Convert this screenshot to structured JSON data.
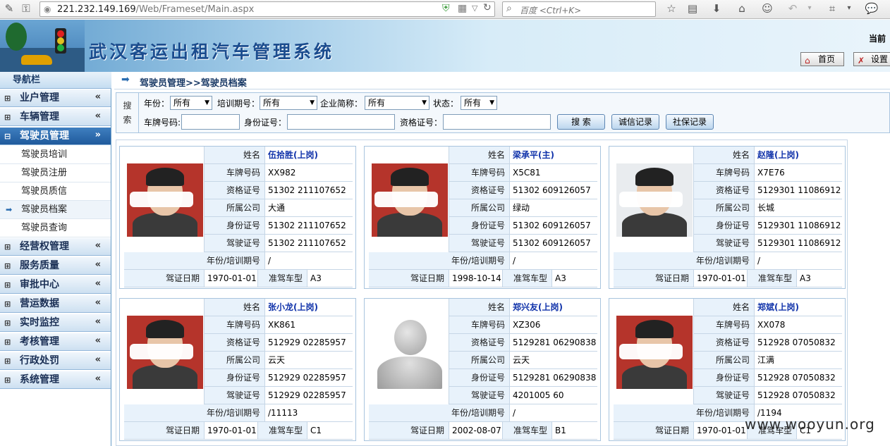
{
  "browser": {
    "url_host": "221.232.149.169",
    "url_path": "/Web/Frameset/Main.aspx",
    "search_placeholder": "百度 <Ctrl+K>"
  },
  "banner": {
    "title": "武汉客运出租汽车管理系统",
    "current_position": "当前",
    "home_label": "首页",
    "settings_label": "设置"
  },
  "sidebar": {
    "header": "导航栏",
    "groups": [
      {
        "label": "业户管理",
        "state": "collapsed"
      },
      {
        "label": "车辆管理",
        "state": "collapsed"
      },
      {
        "label": "驾驶员管理",
        "state": "expanded"
      },
      {
        "label": "经营权管理",
        "state": "collapsed"
      },
      {
        "label": "服务质量",
        "state": "collapsed"
      },
      {
        "label": "审批中心",
        "state": "collapsed"
      },
      {
        "label": "营运数据",
        "state": "collapsed"
      },
      {
        "label": "实时监控",
        "state": "collapsed"
      },
      {
        "label": "考核管理",
        "state": "collapsed"
      },
      {
        "label": "行政处罚",
        "state": "collapsed"
      },
      {
        "label": "系统管理",
        "state": "collapsed"
      }
    ],
    "driver_sub_items": [
      "驾驶员培训",
      "驾驶员注册",
      "驾驶员质信",
      "驾驶员档案",
      "驾驶员查询"
    ],
    "current_sub_item": "驾驶员档案"
  },
  "breadcrumb": "驾驶员管理>>驾驶员档案",
  "search": {
    "side_label_1": "搜",
    "side_label_2": "索",
    "year_label": "年份：",
    "year_value": "所有",
    "period_label": "培训期号：",
    "period_value": "所有",
    "company_label": "企业简称：",
    "company_value": "所有",
    "status_label": "状态：",
    "status_value": "所有",
    "plate_label": "车牌号码:",
    "id_label": "身份证号：",
    "cert_label": "资格证号：",
    "search_button": "搜 索",
    "integrity_button": "诚信记录",
    "social_button": "社保记录"
  },
  "field_labels": {
    "name": "姓名",
    "plate": "车牌号码",
    "cert": "资格证号",
    "company": "所属公司",
    "id": "身份证号",
    "license": "驾驶证号",
    "year_period": "年份/培训期号",
    "license_date": "驾证日期",
    "vehicle_type": "准驾车型"
  },
  "drivers": [
    {
      "name": "伍拾胜(上岗)",
      "plate": "XX982",
      "cert": "51302      211107652",
      "company": "大通",
      "id": "51302      211107652",
      "license": "51302      211107652",
      "year_period": "/",
      "license_date": "1970-01-01",
      "vehicle_type": "A3",
      "photo": "redbg"
    },
    {
      "name": "梁承平(主)",
      "plate": "X5C81",
      "cert": "51302    609126057",
      "company": "绿动",
      "id": "51302    609126057",
      "license": "51302    609126057",
      "year_period": "/",
      "license_date": "1998-10-14",
      "vehicle_type": "A3",
      "photo": "redbg"
    },
    {
      "name": "赵隆(上岗)",
      "plate": "X7E76",
      "cert": "5129301      11086912",
      "company": "长城",
      "id": "5129301      11086912",
      "license": "5129301      11086912",
      "year_period": "/",
      "license_date": "1970-01-01",
      "vehicle_type": "A3",
      "photo": "greybg"
    },
    {
      "name": "张小龙(上岗)",
      "plate": "XK861",
      "cert": "512929    02285957",
      "company": "云天",
      "id": "512929    02285957",
      "license": "512929    02285957",
      "year_period": "/11113",
      "license_date": "1970-01-01",
      "vehicle_type": "C1",
      "photo": "redbg"
    },
    {
      "name": "郑兴友(上岗)",
      "plate": "XZ306",
      "cert": "5129281    06290838",
      "company": "云天",
      "id": "5129281    06290838",
      "license": "4201005    60",
      "year_period": "/",
      "license_date": "2002-08-07",
      "vehicle_type": "B1",
      "photo": "default"
    },
    {
      "name": "郑斌(上岗)",
      "plate": "XX078",
      "cert": "512928    07050832",
      "company": "江满",
      "id": "512928    07050832",
      "license": "512928    07050832",
      "year_period": "/1194",
      "license_date": "1970-01-01",
      "vehicle_type": "C1",
      "photo": "redbg"
    }
  ],
  "watermark": "www.wooyun.org",
  "colors": {
    "accent": "#1f5a9c",
    "name_link": "#1133aa",
    "label_bg": "#e8f2fb"
  }
}
